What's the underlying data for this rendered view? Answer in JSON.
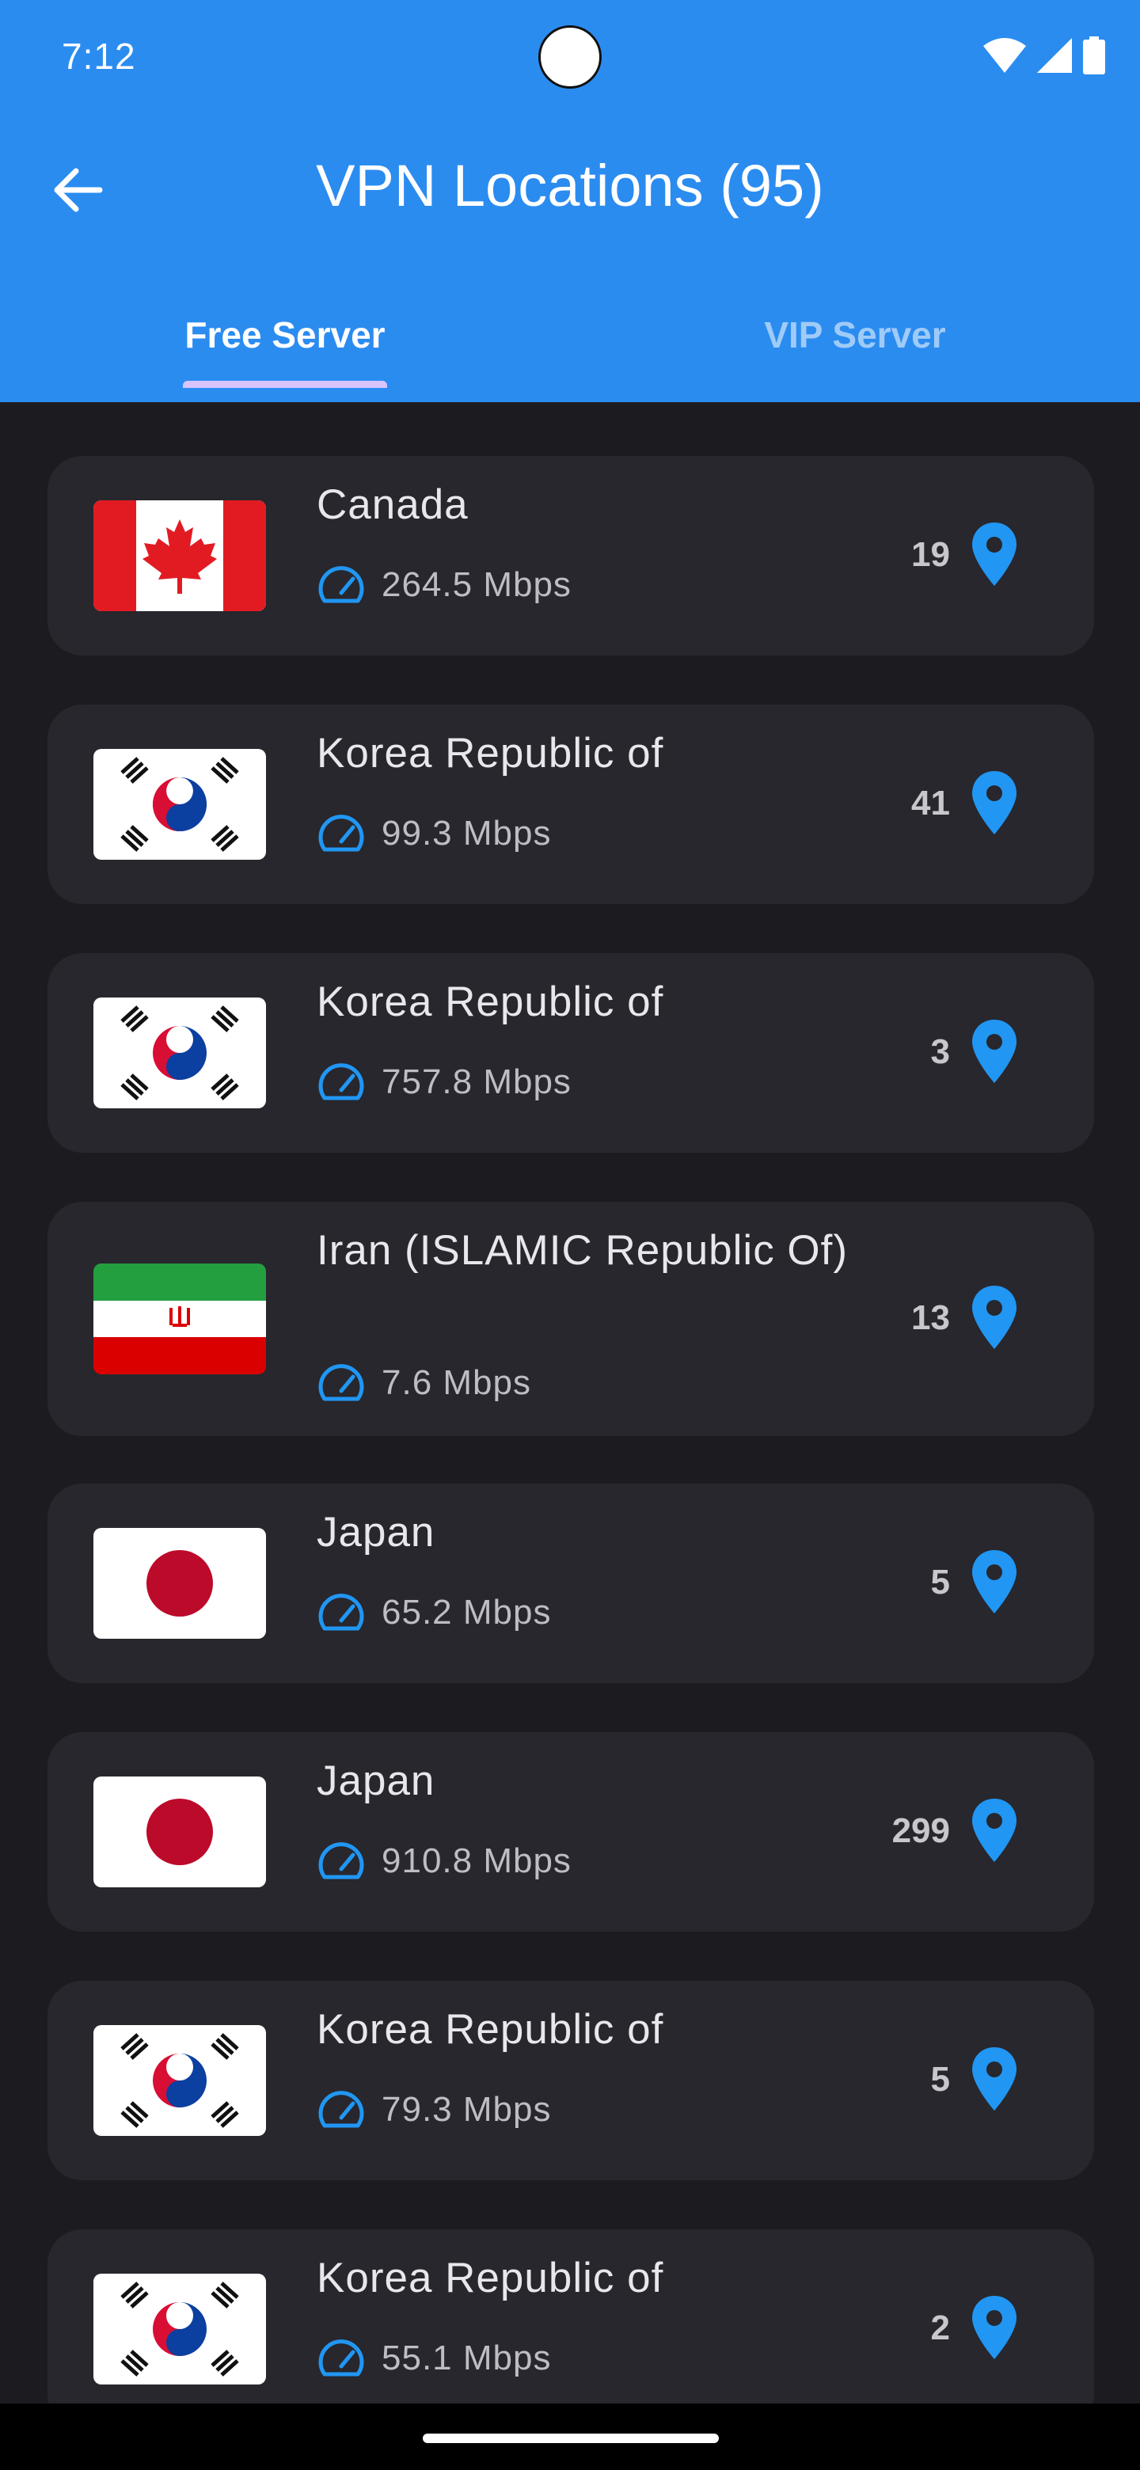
{
  "status_bar": {
    "time": "7:12"
  },
  "app_bar": {
    "title": "VPN Locations (95)"
  },
  "tabs": [
    {
      "label": "Free Server",
      "selected": true
    },
    {
      "label": "VIP Server",
      "selected": false
    }
  ],
  "colors": {
    "header": "#2b8cf0",
    "background": "#1c1c20",
    "card": "#27272d",
    "accent_blue": "#2196f3",
    "tab_indicator": "#d8c4ff"
  },
  "servers": [
    {
      "country": "Canada",
      "speed": "264.5 Mbps",
      "count": "19",
      "flag": "canada-flag"
    },
    {
      "country": "Korea Republic of",
      "speed": "99.3 Mbps",
      "count": "41",
      "flag": "south-korea-flag"
    },
    {
      "country": "Korea Republic of",
      "speed": "757.8 Mbps",
      "count": "3",
      "flag": "south-korea-flag"
    },
    {
      "country": "Iran (ISLAMIC Republic Of)",
      "speed": "7.6 Mbps",
      "count": "13",
      "flag": "iran-flag"
    },
    {
      "country": "Japan",
      "speed": "65.2 Mbps",
      "count": "5",
      "flag": "japan-flag"
    },
    {
      "country": "Japan",
      "speed": "910.8 Mbps",
      "count": "299",
      "flag": "japan-flag"
    },
    {
      "country": "Korea Republic of",
      "speed": "79.3 Mbps",
      "count": "5",
      "flag": "south-korea-flag"
    },
    {
      "country": "Korea Republic of",
      "speed": "55.1 Mbps",
      "count": "2",
      "flag": "south-korea-flag"
    }
  ]
}
